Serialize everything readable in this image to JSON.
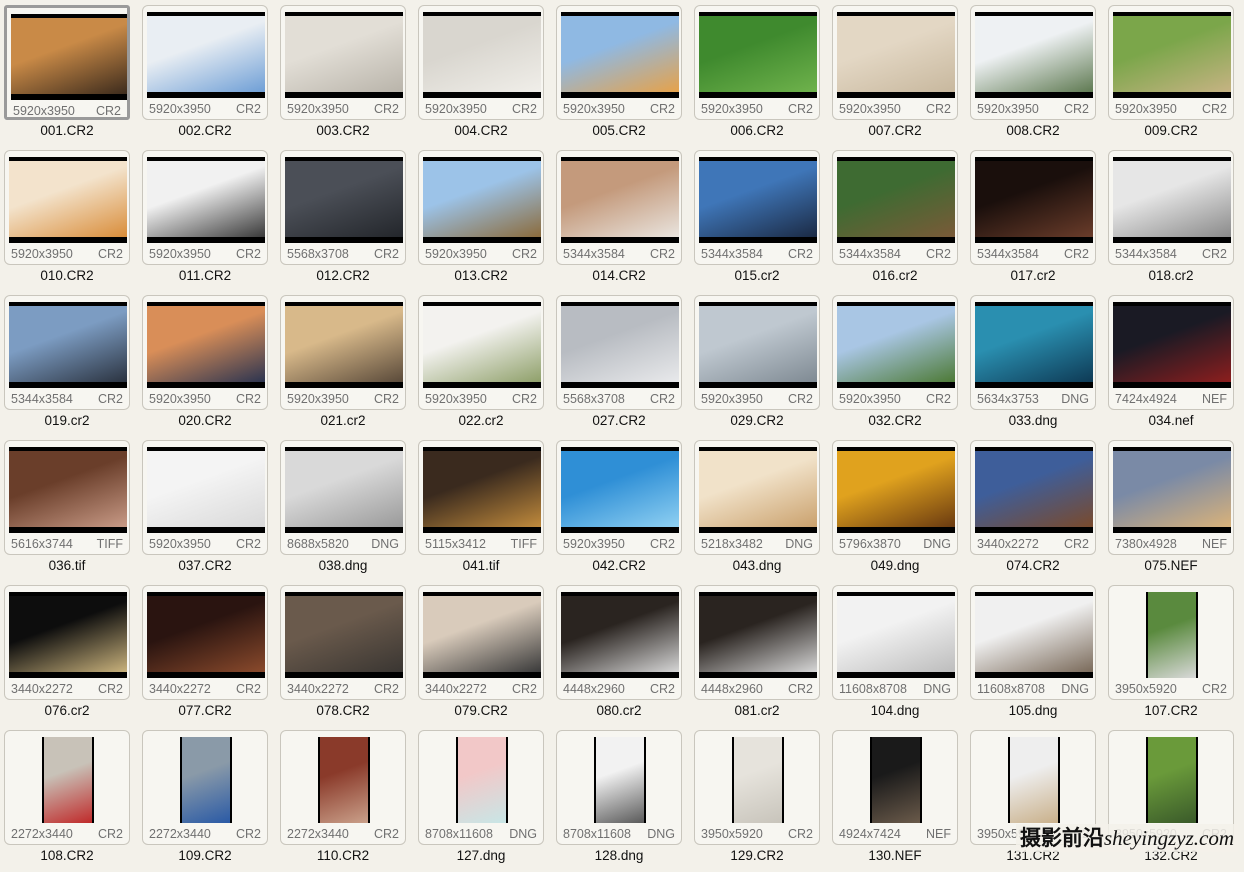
{
  "gallery": {
    "items": [
      {
        "name": "001.CR2",
        "dims": "5920x3950",
        "type": "CR2",
        "orientation": "landscape",
        "colors": [
          "#c98a47",
          "#3b2a1c"
        ],
        "selected": true
      },
      {
        "name": "002.CR2",
        "dims": "5920x3950",
        "type": "CR2",
        "orientation": "landscape",
        "colors": [
          "#e9eef3",
          "#6f9fd6"
        ]
      },
      {
        "name": "003.CR2",
        "dims": "5920x3950",
        "type": "CR2",
        "orientation": "landscape",
        "colors": [
          "#e2ded6",
          "#b9b4aa"
        ]
      },
      {
        "name": "004.CR2",
        "dims": "5920x3950",
        "type": "CR2",
        "orientation": "landscape",
        "colors": [
          "#d9d6cf",
          "#f0eee9"
        ]
      },
      {
        "name": "005.CR2",
        "dims": "5920x3950",
        "type": "CR2",
        "orientation": "landscape",
        "colors": [
          "#8fb9e3",
          "#e6a24a"
        ]
      },
      {
        "name": "006.CR2",
        "dims": "5920x3950",
        "type": "CR2",
        "orientation": "landscape",
        "colors": [
          "#3f8a2e",
          "#6fb24c"
        ]
      },
      {
        "name": "007.CR2",
        "dims": "5920x3950",
        "type": "CR2",
        "orientation": "landscape",
        "colors": [
          "#e3d7c4",
          "#c8b89e"
        ]
      },
      {
        "name": "008.CR2",
        "dims": "5920x3950",
        "type": "CR2",
        "orientation": "landscape",
        "colors": [
          "#eef1f3",
          "#5f7a52"
        ]
      },
      {
        "name": "009.CR2",
        "dims": "5920x3950",
        "type": "CR2",
        "orientation": "landscape",
        "colors": [
          "#7ba64a",
          "#c6b383"
        ]
      },
      {
        "name": "010.CR2",
        "dims": "5920x3950",
        "type": "CR2",
        "orientation": "landscape",
        "colors": [
          "#f3e3cc",
          "#d98d3a"
        ]
      },
      {
        "name": "011.CR2",
        "dims": "5920x3950",
        "type": "CR2",
        "orientation": "landscape",
        "colors": [
          "#f1f1f1",
          "#3a3a3a"
        ]
      },
      {
        "name": "012.CR2",
        "dims": "5568x3708",
        "type": "CR2",
        "orientation": "landscape",
        "colors": [
          "#4b4f57",
          "#23262b"
        ]
      },
      {
        "name": "013.CR2",
        "dims": "5920x3950",
        "type": "CR2",
        "orientation": "landscape",
        "colors": [
          "#9cc3e8",
          "#8b6b3c"
        ]
      },
      {
        "name": "014.CR2",
        "dims": "5344x3584",
        "type": "CR2",
        "orientation": "landscape",
        "colors": [
          "#c49a7c",
          "#e9e4de"
        ]
      },
      {
        "name": "015.cr2",
        "dims": "5344x3584",
        "type": "CR2",
        "orientation": "landscape",
        "colors": [
          "#3f76b8",
          "#1b2a44"
        ]
      },
      {
        "name": "016.cr2",
        "dims": "5344x3584",
        "type": "CR2",
        "orientation": "landscape",
        "colors": [
          "#3e6b32",
          "#7a5a38"
        ]
      },
      {
        "name": "017.cr2",
        "dims": "5344x3584",
        "type": "CR2",
        "orientation": "landscape",
        "colors": [
          "#1a0f0c",
          "#6a3c2a"
        ]
      },
      {
        "name": "018.cr2",
        "dims": "5344x3584",
        "type": "CR2",
        "orientation": "landscape",
        "colors": [
          "#e6e6e6",
          "#8a8a8a"
        ]
      },
      {
        "name": "019.cr2",
        "dims": "5344x3584",
        "type": "CR2",
        "orientation": "landscape",
        "colors": [
          "#7c9cc2",
          "#2b3340"
        ]
      },
      {
        "name": "020.CR2",
        "dims": "5920x3950",
        "type": "CR2",
        "orientation": "landscape",
        "colors": [
          "#d98e58",
          "#2c3450"
        ]
      },
      {
        "name": "021.cr2",
        "dims": "5920x3950",
        "type": "CR2",
        "orientation": "landscape",
        "colors": [
          "#d8b98a",
          "#5a4a3a"
        ]
      },
      {
        "name": "022.cr2",
        "dims": "5920x3950",
        "type": "CR2",
        "orientation": "landscape",
        "colors": [
          "#f3f2ef",
          "#8fa06a"
        ]
      },
      {
        "name": "027.CR2",
        "dims": "5568x3708",
        "type": "CR2",
        "orientation": "landscape",
        "colors": [
          "#b8bcc2",
          "#e8e9eb"
        ]
      },
      {
        "name": "029.CR2",
        "dims": "5920x3950",
        "type": "CR2",
        "orientation": "landscape",
        "colors": [
          "#bfc8d0",
          "#7f8a93"
        ]
      },
      {
        "name": "032.CR2",
        "dims": "5920x3950",
        "type": "CR2",
        "orientation": "landscape",
        "colors": [
          "#a9c6e4",
          "#4d7a36"
        ]
      },
      {
        "name": "033.dng",
        "dims": "5634x3753",
        "type": "DNG",
        "orientation": "landscape",
        "colors": [
          "#2a8fb0",
          "#0e3a55"
        ]
      },
      {
        "name": "034.nef",
        "dims": "7424x4924",
        "type": "NEF",
        "orientation": "landscape",
        "colors": [
          "#1a1a24",
          "#8c1e1e"
        ]
      },
      {
        "name": "036.tif",
        "dims": "5616x3744",
        "type": "TIFF",
        "orientation": "landscape",
        "colors": [
          "#6a3e2a",
          "#c89a86"
        ]
      },
      {
        "name": "037.CR2",
        "dims": "5920x3950",
        "type": "CR2",
        "orientation": "landscape",
        "colors": [
          "#f4f4f4",
          "#d9d9d9"
        ]
      },
      {
        "name": "038.dng",
        "dims": "8688x5820",
        "type": "DNG",
        "orientation": "landscape",
        "colors": [
          "#d9d9d9",
          "#9a9a9a"
        ]
      },
      {
        "name": "041.tif",
        "dims": "5115x3412",
        "type": "TIFF",
        "orientation": "landscape",
        "colors": [
          "#3a2a1e",
          "#c08a3c"
        ]
      },
      {
        "name": "042.CR2",
        "dims": "5920x3950",
        "type": "CR2",
        "orientation": "landscape",
        "colors": [
          "#2f8fd6",
          "#8fd0f2"
        ]
      },
      {
        "name": "043.dng",
        "dims": "5218x3482",
        "type": "DNG",
        "orientation": "landscape",
        "colors": [
          "#f1e2c9",
          "#caa16d"
        ]
      },
      {
        "name": "049.dng",
        "dims": "5796x3870",
        "type": "DNG",
        "orientation": "landscape",
        "colors": [
          "#e0a21e",
          "#6a3a10"
        ]
      },
      {
        "name": "074.CR2",
        "dims": "3440x2272",
        "type": "CR2",
        "orientation": "landscape",
        "colors": [
          "#3e5e9a",
          "#7a4a2c"
        ]
      },
      {
        "name": "075.NEF",
        "dims": "7380x4928",
        "type": "NEF",
        "orientation": "landscape",
        "colors": [
          "#7a8aa6",
          "#d9b27a"
        ]
      },
      {
        "name": "076.cr2",
        "dims": "3440x2272",
        "type": "CR2",
        "orientation": "landscape",
        "colors": [
          "#0d0d0d",
          "#c9b27c"
        ]
      },
      {
        "name": "077.CR2",
        "dims": "3440x2272",
        "type": "CR2",
        "orientation": "landscape",
        "colors": [
          "#2a1410",
          "#8a4a2c"
        ]
      },
      {
        "name": "078.CR2",
        "dims": "3440x2272",
        "type": "CR2",
        "orientation": "landscape",
        "colors": [
          "#6a5a4c",
          "#3a3632"
        ]
      },
      {
        "name": "079.CR2",
        "dims": "3440x2272",
        "type": "CR2",
        "orientation": "landscape",
        "colors": [
          "#d9cbbb",
          "#3a3a3a"
        ]
      },
      {
        "name": "080.cr2",
        "dims": "4448x2960",
        "type": "CR2",
        "orientation": "landscape",
        "colors": [
          "#2a2420",
          "#d6d6d6"
        ]
      },
      {
        "name": "081.cr2",
        "dims": "4448x2960",
        "type": "CR2",
        "orientation": "landscape",
        "colors": [
          "#2a2420",
          "#d6d6d6"
        ]
      },
      {
        "name": "104.dng",
        "dims": "11608x8708",
        "type": "DNG",
        "orientation": "landscape",
        "colors": [
          "#f2f2f2",
          "#bdbdbd"
        ]
      },
      {
        "name": "105.dng",
        "dims": "11608x8708",
        "type": "DNG",
        "orientation": "landscape",
        "colors": [
          "#f0f0f0",
          "#7a6a5a"
        ]
      },
      {
        "name": "107.CR2",
        "dims": "3950x5920",
        "type": "CR2",
        "orientation": "portrait",
        "colors": [
          "#5a8a3e",
          "#d9d9d9"
        ]
      },
      {
        "name": "108.CR2",
        "dims": "2272x3440",
        "type": "CR2",
        "orientation": "portrait",
        "colors": [
          "#c8c2b8",
          "#c02a2a"
        ]
      },
      {
        "name": "109.CR2",
        "dims": "2272x3440",
        "type": "CR2",
        "orientation": "portrait",
        "colors": [
          "#8a9aa8",
          "#2a5aa6"
        ]
      },
      {
        "name": "110.CR2",
        "dims": "2272x3440",
        "type": "CR2",
        "orientation": "portrait",
        "colors": [
          "#8a3a2a",
          "#caa08a"
        ]
      },
      {
        "name": "127.dng",
        "dims": "8708x11608",
        "type": "DNG",
        "orientation": "portrait",
        "colors": [
          "#f2c8c8",
          "#c8e6e6"
        ]
      },
      {
        "name": "128.dng",
        "dims": "8708x11608",
        "type": "DNG",
        "orientation": "portrait",
        "colors": [
          "#f2f2f2",
          "#5a5a5a"
        ]
      },
      {
        "name": "129.CR2",
        "dims": "3950x5920",
        "type": "CR2",
        "orientation": "portrait",
        "colors": [
          "#e6e3dc",
          "#c8c4bb"
        ]
      },
      {
        "name": "130.NEF",
        "dims": "4924x7424",
        "type": "NEF",
        "orientation": "portrait",
        "colors": [
          "#1a1a1a",
          "#6a5a4a"
        ]
      },
      {
        "name": "131.CR2",
        "dims": "3950x5920",
        "type": "CR2",
        "orientation": "portrait",
        "colors": [
          "#eeeeee",
          "#c9b08a"
        ]
      },
      {
        "name": "132.CR2",
        "dims": "3950x5920",
        "type": "CR2",
        "orientation": "portrait",
        "colors": [
          "#6a9a3a",
          "#3a5a2a"
        ]
      }
    ]
  },
  "watermark": {
    "cn": "摄影前沿",
    "en": "sheyingzyz.com"
  }
}
